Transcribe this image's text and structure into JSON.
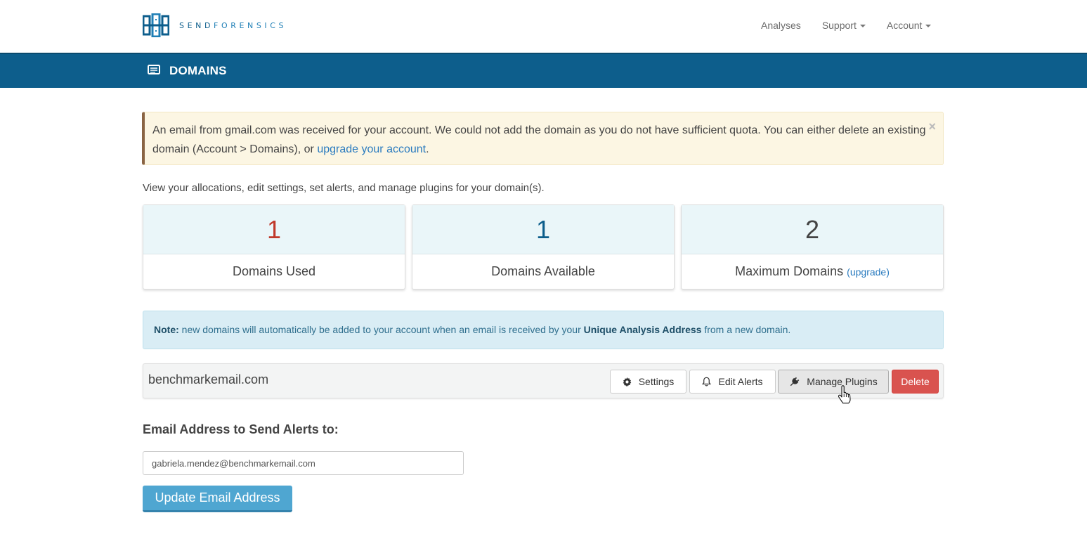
{
  "brand": {
    "logo_text_prefix": "SEND",
    "logo_text_suffix": "FORENSICS",
    "color": "#0d5e8c"
  },
  "nav": {
    "analyses": "Analyses",
    "support": "Support",
    "account": "Account"
  },
  "page": {
    "title": "DOMAINS",
    "icon": "list-card-icon"
  },
  "alert": {
    "text_before_link": "An email from gmail.com was received for your account. We could not add the domain as you do not have sufficient quota. You can either delete an existing domain (Account > Domains), or ",
    "link_text": "upgrade your account",
    "text_after_link": ".",
    "close": "×"
  },
  "intro": "View your allocations, edit settings, set alerts, and manage plugins for your domain(s).",
  "stats": {
    "used": {
      "value": "1",
      "label": "Domains Used",
      "color": "#c0392b"
    },
    "available": {
      "value": "1",
      "label": "Domains Available",
      "color": "#0d5e8c"
    },
    "maximum": {
      "value": "2",
      "label": "Maximum Domains",
      "link": "(upgrade)",
      "color": "#444444"
    }
  },
  "note": {
    "label": "Note:",
    "text_before": "new domains will automatically be added to your account when an email is received by your",
    "bold": "Unique Analysis Address",
    "text_after": "from a new domain."
  },
  "domain": {
    "name": "benchmarkemail.com",
    "settings": "Settings",
    "edit_alerts": "Edit Alerts",
    "manage_plugins": "Manage Plugins",
    "delete": "Delete"
  },
  "alerts_form": {
    "label": "Email Address to Send Alerts to:",
    "email_value": "gabriela.mendez@benchmarkemail.com",
    "submit": "Update Email Address"
  }
}
